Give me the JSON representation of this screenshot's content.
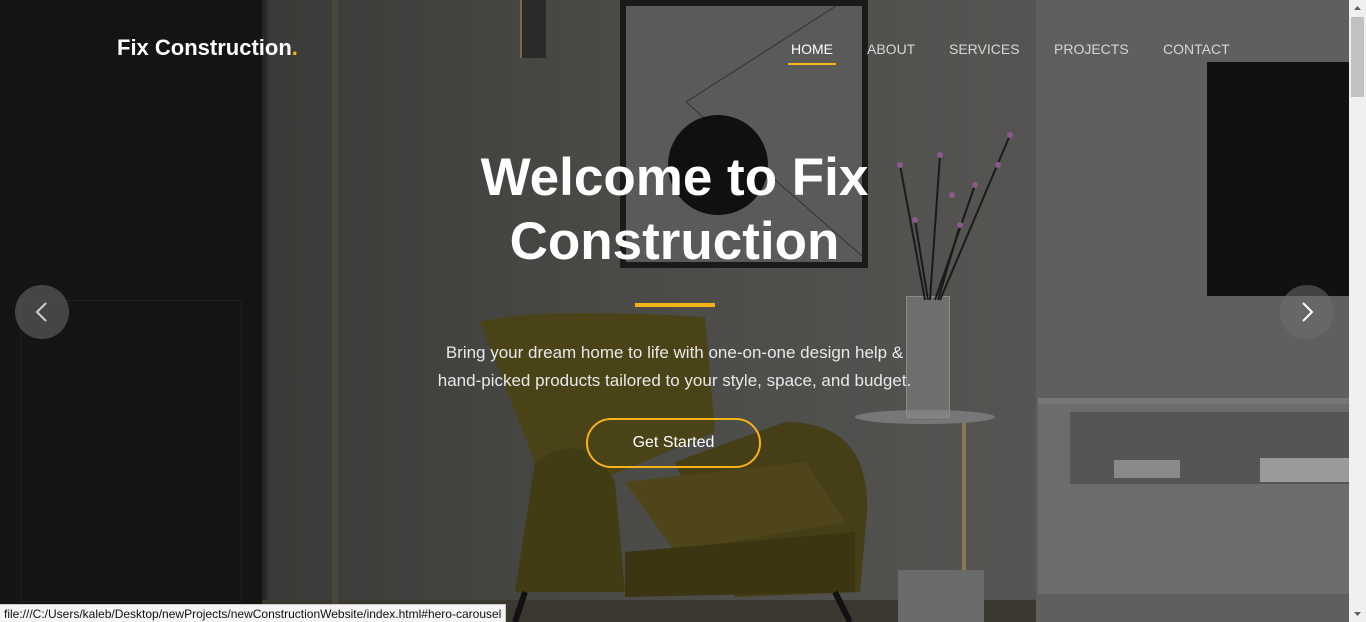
{
  "brand": {
    "name": "Fix Construction",
    "dot": "."
  },
  "nav": {
    "items": [
      {
        "label": "HOME",
        "active": true
      },
      {
        "label": "ABOUT",
        "active": false
      },
      {
        "label": "SERVICES",
        "active": false
      },
      {
        "label": "PROJECTS",
        "active": false
      },
      {
        "label": "CONTACT",
        "active": false
      }
    ]
  },
  "hero": {
    "title_line1": "Welcome to Fix",
    "title_line2": "Construction",
    "text_line1": "Bring your dream home to life with one-on-one design help &",
    "text_line2": "hand-picked products tailored to your style, space, and budget.",
    "cta_label": "Get Started"
  },
  "carousel": {
    "prev_icon": "chevron-left-icon",
    "next_icon": "chevron-right-icon"
  },
  "status_bar": {
    "url": "file:///C:/Users/kaleb/Desktop/newProjects/newConstructionWebsite/index.html#hero-carousel"
  },
  "colors": {
    "accent": "#f5b31a",
    "text": "#ffffff"
  }
}
